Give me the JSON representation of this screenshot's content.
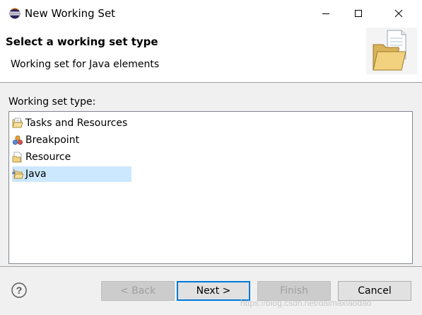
{
  "window": {
    "title": "New Working Set",
    "icon": "eclipse-icon"
  },
  "header": {
    "title": "Select a working set type",
    "description": "Working set for Java elements",
    "banner_icon": "folder-document-icon"
  },
  "list": {
    "label": "Working set type:",
    "items": [
      {
        "label": "Tasks and Resources",
        "icon": "tasks-resources-icon",
        "selected": false
      },
      {
        "label": "Breakpoint",
        "icon": "breakpoint-icon",
        "selected": false
      },
      {
        "label": "Resource",
        "icon": "resource-icon",
        "selected": false
      },
      {
        "label": "Java",
        "icon": "java-package-icon",
        "selected": true
      }
    ]
  },
  "footer": {
    "help_icon": "help-icon",
    "back_label": "< Back",
    "next_label": "Next >",
    "finish_label": "Finish",
    "cancel_label": "Cancel",
    "watermark": "https://blog.csdn.net/daimaxiaodao"
  },
  "colors": {
    "selection": "#cce8ff",
    "default_button_border": "#0078d7",
    "body_background": "#f0f0f0"
  }
}
